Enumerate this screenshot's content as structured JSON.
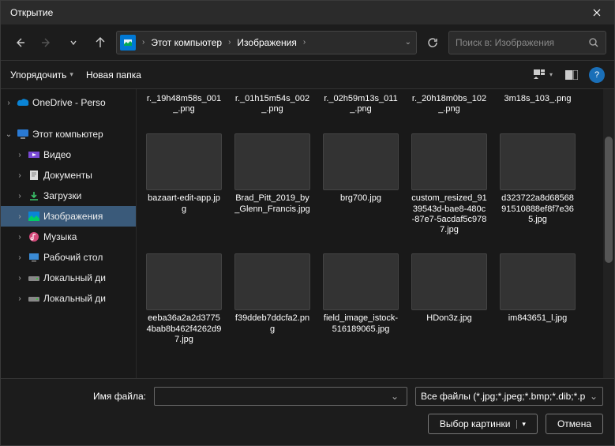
{
  "title": "Открытие",
  "breadcrumb": {
    "root": "Этот компьютер",
    "folder": "Изображения"
  },
  "search": {
    "placeholder": "Поиск в: Изображения"
  },
  "toolbar": {
    "organize": "Упорядочить",
    "newfolder": "Новая папка"
  },
  "sidebar": {
    "onedrive": "OneDrive - Perso",
    "thispc": "Этот компьютер",
    "items": [
      {
        "label": "Видео"
      },
      {
        "label": "Документы"
      },
      {
        "label": "Загрузки"
      },
      {
        "label": "Изображения"
      },
      {
        "label": "Музыка"
      },
      {
        "label": "Рабочий стол"
      },
      {
        "label": "Локальный ди"
      },
      {
        "label": "Локальный ди"
      }
    ]
  },
  "files_partial": [
    {
      "name": "r._19h48m58s_001_.png"
    },
    {
      "name": "r._01h15m54s_002_.png"
    },
    {
      "name": "r._02h59m13s_011_.png"
    },
    {
      "name": "r._20h18m0bs_102_.png"
    },
    {
      "name": "3m18s_103_.png"
    }
  ],
  "files_row1": [
    {
      "name": "bazaart-edit-app.jpg",
      "art": "art-bazaart"
    },
    {
      "name": "Brad_Pitt_2019_by_Glenn_Francis.jpg",
      "art": "art-brad"
    },
    {
      "name": "brg700.jpg",
      "art": "art-brg"
    },
    {
      "name": "custom_resized_9139543d-bae8-480c-87e7-5acdaf5c9787.jpg",
      "art": "art-custom"
    },
    {
      "name": "d323722a8d6856891510888ef8f7e365.jpg",
      "art": "art-dark"
    }
  ],
  "files_row2": [
    {
      "name": "eeba36a2a2d37754bab8b462f4262d97.jpg",
      "art": "art-portrait1"
    },
    {
      "name": "f39ddeb7ddcfa2.png",
      "art": "art-note"
    },
    {
      "name": "field_image_istock-516189065.jpg",
      "art": "art-field"
    },
    {
      "name": "HDon3z.jpg",
      "art": "art-portrait2"
    },
    {
      "name": "im843651_l.jpg",
      "art": "art-painting"
    }
  ],
  "footer": {
    "filename_label": "Имя файла:",
    "filename_value": "",
    "filter": "Все файлы (*.jpg;*.jpeg;*.bmp;*.dib;*.p",
    "open": "Выбор картинки",
    "cancel": "Отмена"
  }
}
